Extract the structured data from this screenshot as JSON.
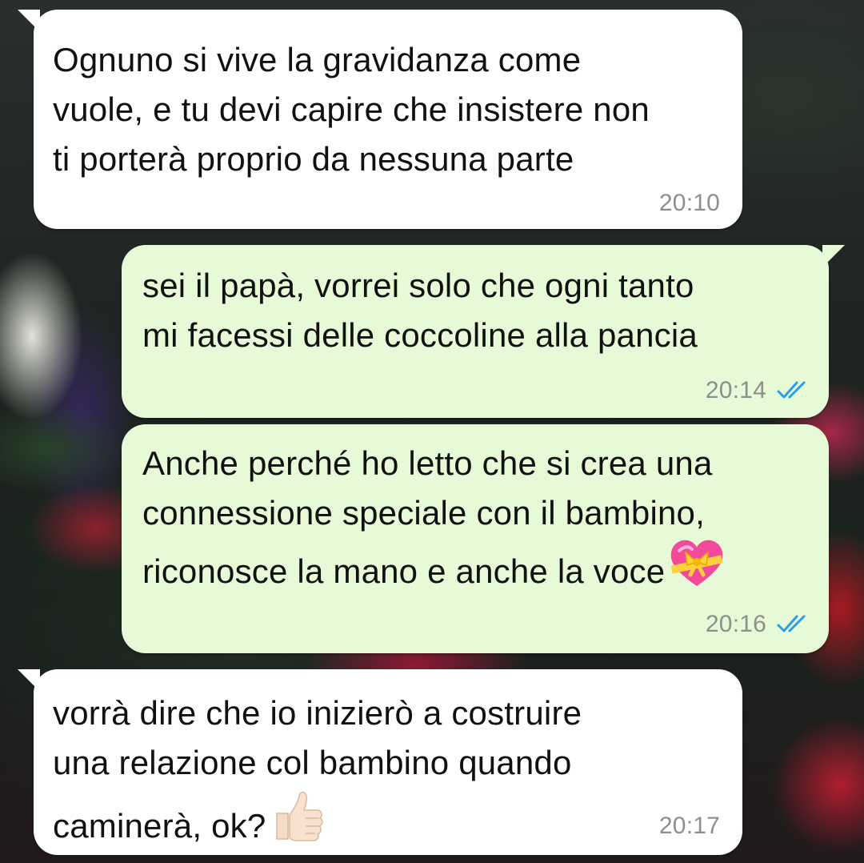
{
  "messages": [
    {
      "direction": "incoming",
      "text": "Ognuno si vive la gravidanza come\nvuole, e tu devi capire che insistere non\nti porterà proprio da nessuna parte",
      "time": "20:10"
    },
    {
      "direction": "outgoing",
      "text": "sei il papà, vorrei solo che ogni tanto\nmi facessi delle coccoline alla pancia",
      "time": "20:14",
      "status_icon": "double-check-icon",
      "status_color": "#2a9ee8"
    },
    {
      "direction": "outgoing",
      "text": "Anche perché ho letto che si crea una\nconnessione speciale con il bambino,\nriconosce la mano e anche la voce",
      "emoji": "heart-with-ribbon-emoji",
      "time": "20:16",
      "status_icon": "double-check-icon",
      "status_color": "#2a9ee8"
    },
    {
      "direction": "incoming",
      "text": "vorrà dire che io inizierò a costruire\nuna relazione col bambino quando\ncaminerà, ok?",
      "emoji": "thumbs-up-emoji",
      "time": "20:17"
    }
  ],
  "colors": {
    "incoming_bubble": "#ffffff",
    "outgoing_bubble": "#e7fad8",
    "timestamp": "#8c8f8c",
    "read_ticks": "#2a9ee8"
  }
}
